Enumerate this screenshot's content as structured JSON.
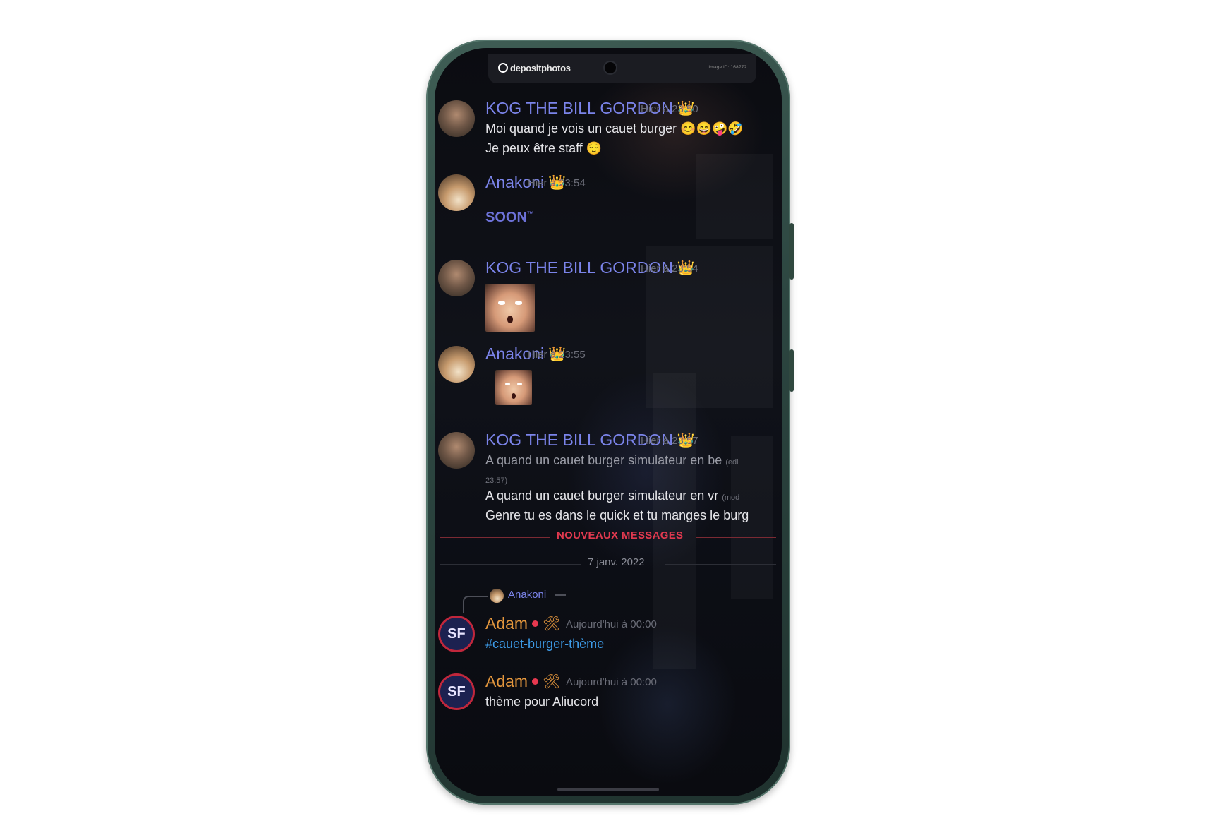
{
  "status_bar": {
    "logo": "depositphotos",
    "stock_id": "Image ID: 168772..."
  },
  "badge_icon": "crown-emoji",
  "messages": [
    {
      "author": "KOG THE BILL GORDON",
      "time": "Hier à 23:50",
      "lines": [
        "Moi quand je vois un cauet burger 😊😄🤪🤣",
        "Je peux être staff 😌"
      ]
    },
    {
      "author": "Anakoni",
      "time": "Hier à 23:54",
      "lines": [
        "SOON",
        "™"
      ]
    },
    {
      "author": "KOG THE BILL GORDON",
      "time": "Hier à 23:54",
      "lines": []
    },
    {
      "author": "Anakoni",
      "time": "Hier à 23:55",
      "lines": []
    },
    {
      "author": "KOG THE BILL GORDON",
      "time": "Hier à 23:57",
      "lines": [
        "A quand un cauet burger simulateur en be",
        "(edi",
        "23:57)",
        "A quand un cauet burger simulateur en vr",
        "(mod",
        "Genre tu es dans le quick et tu manges le burg"
      ]
    }
  ],
  "dividers": {
    "new_messages": "NOUVEAUX MESSAGES",
    "date": "7 janv. 2022"
  },
  "reply": {
    "author": "Anakoni"
  },
  "adam_messages": [
    {
      "author": "Adam",
      "tools_icon": "🛠",
      "time": "Aujourd'hui à 00:00",
      "text": "#cauet-burger-thème"
    },
    {
      "author": "Adam",
      "tools_icon": "🛠",
      "time": "Aujourd'hui à 00:00",
      "text": "thème pour Aliucord"
    }
  ],
  "adam_avatar": "SF",
  "colors": {
    "name_blue": "#7b84ea",
    "name_orange": "#e3963d",
    "new_messages": "#e1394f",
    "channel_link": "#3d9be8"
  }
}
